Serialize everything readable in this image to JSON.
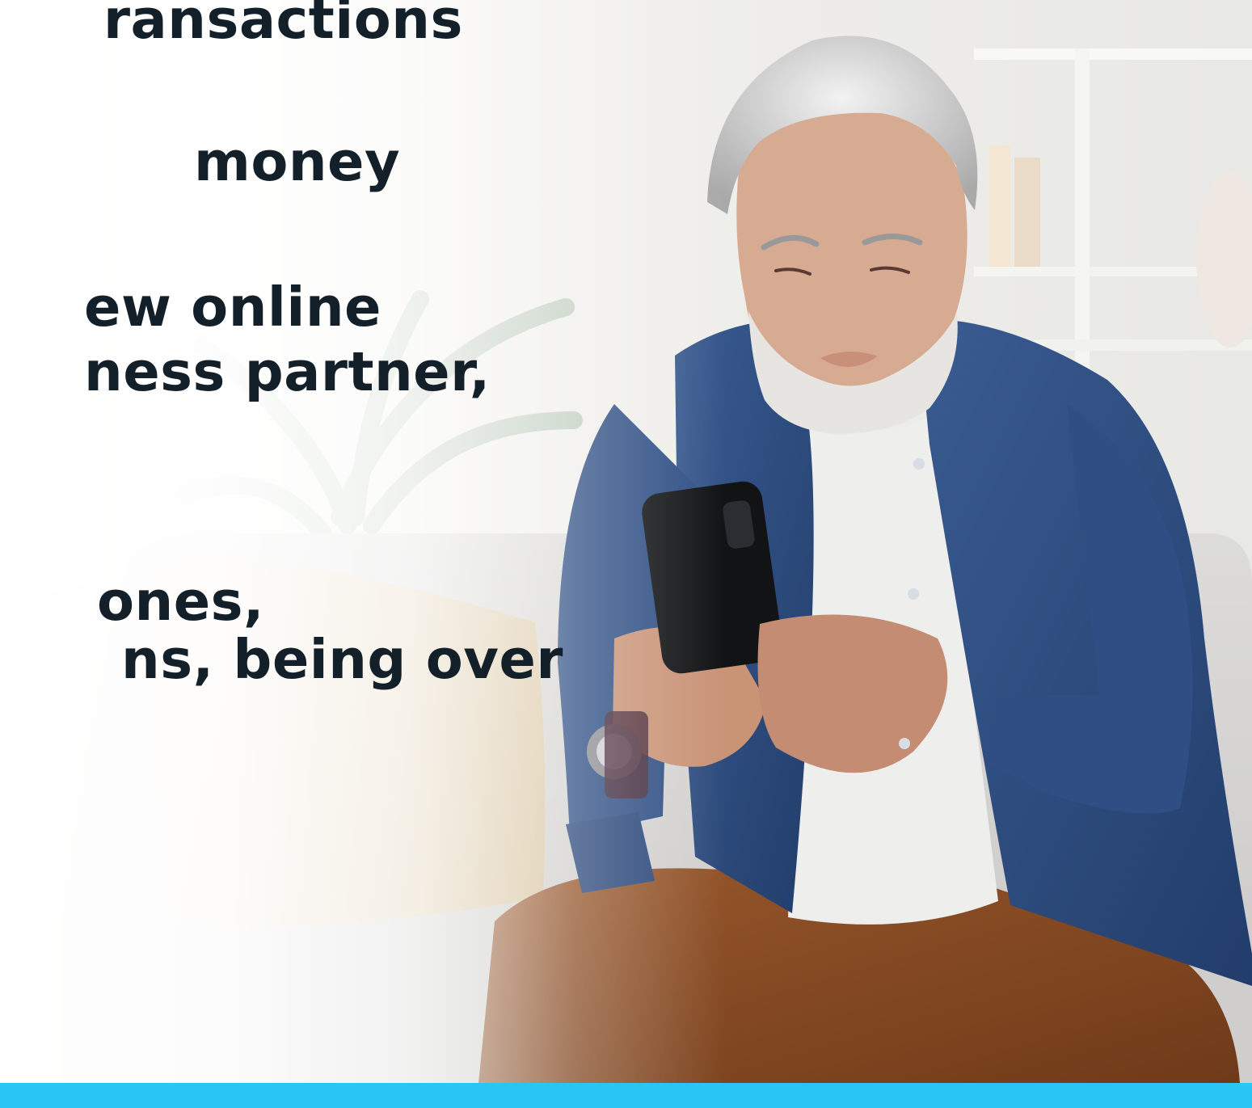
{
  "headline": {
    "line_1": "ransactions",
    "line_2": "money",
    "line_3": "ew online",
    "line_4": "ness partner,",
    "line_5": "ones,",
    "line_6": "ns, being over"
  },
  "colors": {
    "text": "#13202a",
    "accent_bar": "#27c6f5",
    "shirt": "#2c4a7e",
    "trousers": "#8a4d25",
    "sofa": "#d7d6d4",
    "cushion": "#e2cfb0"
  }
}
